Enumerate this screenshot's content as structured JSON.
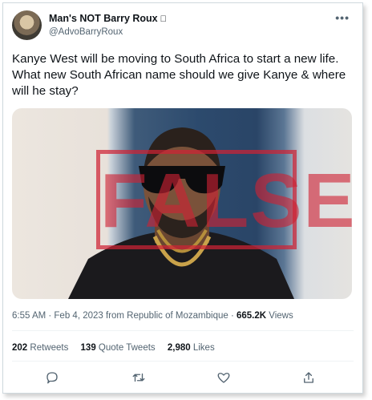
{
  "tweet": {
    "display_name": "Man's NOT Barry Roux",
    "verified_glyph": "",
    "handle": "@AdvoBarryRoux",
    "text": "Kanye West will be moving to South Africa to start a new life. What new South African name should we give Kanye & where will he stay?",
    "stamp_text": "FALSE",
    "timestamp": "6:55 AM · Feb 4, 2023 from Republic of Mozambique · ",
    "views_count": "665.2K",
    "views_label": " Views",
    "retweets_count": "202",
    "retweets_label": " Retweets",
    "quotes_count": "139",
    "quotes_label": " Quote Tweets",
    "likes_count": "2,980",
    "likes_label": " Likes"
  },
  "icons": {
    "more": "more-icon",
    "reply": "reply-icon",
    "retweet": "retweet-icon",
    "like": "like-icon",
    "share": "share-icon"
  },
  "colors": {
    "stamp": "#ce2234",
    "muted": "#536471",
    "text": "#0f1419"
  }
}
